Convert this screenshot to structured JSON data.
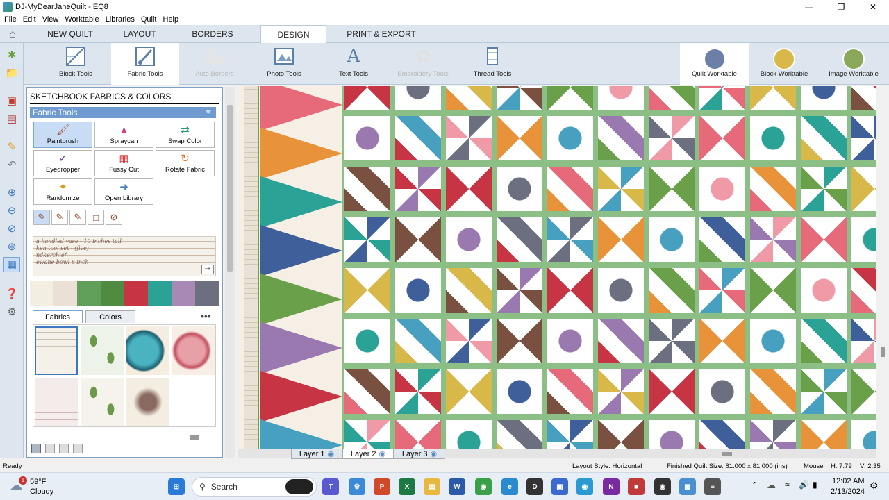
{
  "window": {
    "title": "DJ-MyDearJaneQuilt - EQ8"
  },
  "menu": [
    "File",
    "Edit",
    "View",
    "Worktable",
    "Libraries",
    "Quilt",
    "Help"
  ],
  "tabs": [
    {
      "label": "NEW QUILT"
    },
    {
      "label": "LAYOUT"
    },
    {
      "label": "BORDERS"
    },
    {
      "label": "DESIGN",
      "active": true
    },
    {
      "label": "PRINT & EXPORT"
    }
  ],
  "ribbon": {
    "tools": [
      {
        "label": "Block Tools",
        "icon": "block-tools-icon"
      },
      {
        "label": "Fabric Tools",
        "icon": "fabric-tools-icon",
        "selected": true
      },
      {
        "label": "Auto Borders",
        "icon": "auto-borders-icon",
        "disabled": true
      },
      {
        "label": "Photo Tools",
        "icon": "photo-tools-icon"
      },
      {
        "label": "Text Tools",
        "icon": "text-tools-icon"
      },
      {
        "label": "Embroidery Tools",
        "icon": "embroidery-tools-icon",
        "disabled": true
      },
      {
        "label": "Thread Tools",
        "icon": "thread-tools-icon"
      }
    ],
    "worktables": [
      {
        "label": "Quilt Worktable",
        "selected": true,
        "color": "#6b7fa8"
      },
      {
        "label": "Block Worktable",
        "color": "#d9b84a"
      },
      {
        "label": "Image Worktable",
        "color": "#8aa85a"
      }
    ]
  },
  "panel": {
    "title": "SKETCHBOOK FABRICS & COLORS",
    "section": "Fabric Tools",
    "tools": [
      {
        "label": "Paintbrush",
        "icon": "paintbrush-icon",
        "selected": true
      },
      {
        "label": "Spraycan",
        "icon": "spraycan-icon"
      },
      {
        "label": "Swap Color",
        "icon": "swap-color-icon"
      },
      {
        "label": "Eyedropper",
        "icon": "eyedropper-icon"
      },
      {
        "label": "Fussy Cut",
        "icon": "fussy-cut-icon"
      },
      {
        "label": "Rotate Fabric",
        "icon": "rotate-fabric-icon"
      },
      {
        "label": "Randomize",
        "icon": "randomize-icon"
      },
      {
        "label": "Open Library",
        "icon": "open-library-icon"
      }
    ],
    "sketch_lines": [
      "a handled vase - 10 inches tall",
      "ken tool set - (five)",
      "ndkerchief",
      "ewane bowl 8 inch"
    ],
    "tabs": [
      {
        "label": "Fabrics",
        "active": true
      },
      {
        "label": "Colors"
      }
    ],
    "swatch_colors": [
      "#f3eee2",
      "#ece0d6",
      "#5f9f5a",
      "#4f8b40",
      "#c73545",
      "#2aa296",
      "#a889b5",
      "#6b6f80"
    ]
  },
  "layers": [
    {
      "label": "Layer 1"
    },
    {
      "label": "Layer 2",
      "active": true
    },
    {
      "label": "Layer 3"
    }
  ],
  "status": {
    "ready": "Ready",
    "layout_style": "Layout Style: Horizontal",
    "finished_size": "Finished Quilt Size: 81.000 x 81.000 (ins)",
    "mouse": "Mouse",
    "h": "H:  7.79",
    "v": "V:  2.35"
  },
  "taskbar": {
    "weather_temp": "59°F",
    "weather_desc": "Cloudy",
    "weather_badge": "1",
    "search": "Search",
    "time": "12:02 AM",
    "date": "2/13/2024"
  }
}
